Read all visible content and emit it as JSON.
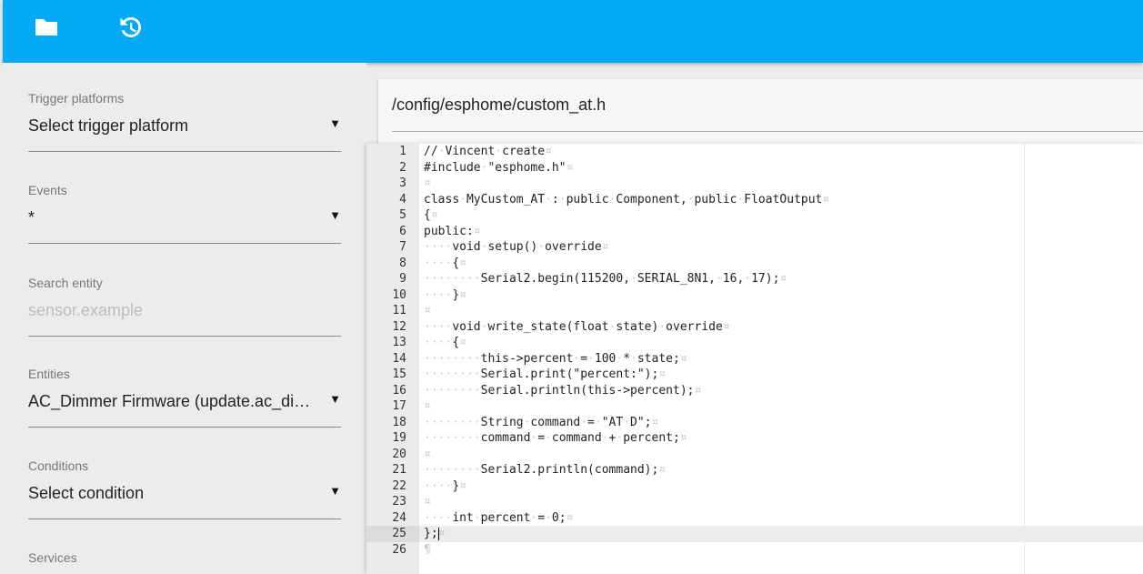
{
  "toolbar": {
    "icons": [
      "folder-icon",
      "history-icon"
    ],
    "color": "#03a9f4"
  },
  "sidebar": {
    "fields": [
      {
        "label": "Trigger platforms",
        "value": "Select trigger platform",
        "has_dropdown": true
      },
      {
        "label": "Events",
        "value": "*",
        "has_dropdown": true
      },
      {
        "label": "Search entity",
        "placeholder": "sensor.example",
        "has_dropdown": false
      },
      {
        "label": "Entities",
        "value": "AC_Dimmer Firmware (update.ac_dimmer_firmware)",
        "has_dropdown": true
      },
      {
        "label": "Conditions",
        "value": "Select condition",
        "has_dropdown": true
      },
      {
        "label": "Services"
      }
    ]
  },
  "editor": {
    "file_path": "/config/esphome/custom_at.h",
    "active_line": 25,
    "lines": [
      "// Vincent create",
      "#include \"esphome.h\"",
      "",
      "class MyCustom_AT : public Component, public FloatOutput",
      "{",
      "public:",
      "    void setup() override",
      "    {",
      "        Serial2.begin(115200, SERIAL_8N1, 16, 17);",
      "    }",
      "",
      "    void write_state(float state) override",
      "    {",
      "        this->percent = 100 * state;",
      "        Serial.print(\"percent:\");",
      "        Serial.println(this->percent);",
      "",
      "        String command = \"AT D\";",
      "        command = command + percent;",
      "",
      "        Serial2.println(command);",
      "    }",
      "",
      "    int percent = 0;",
      "};",
      ""
    ]
  }
}
